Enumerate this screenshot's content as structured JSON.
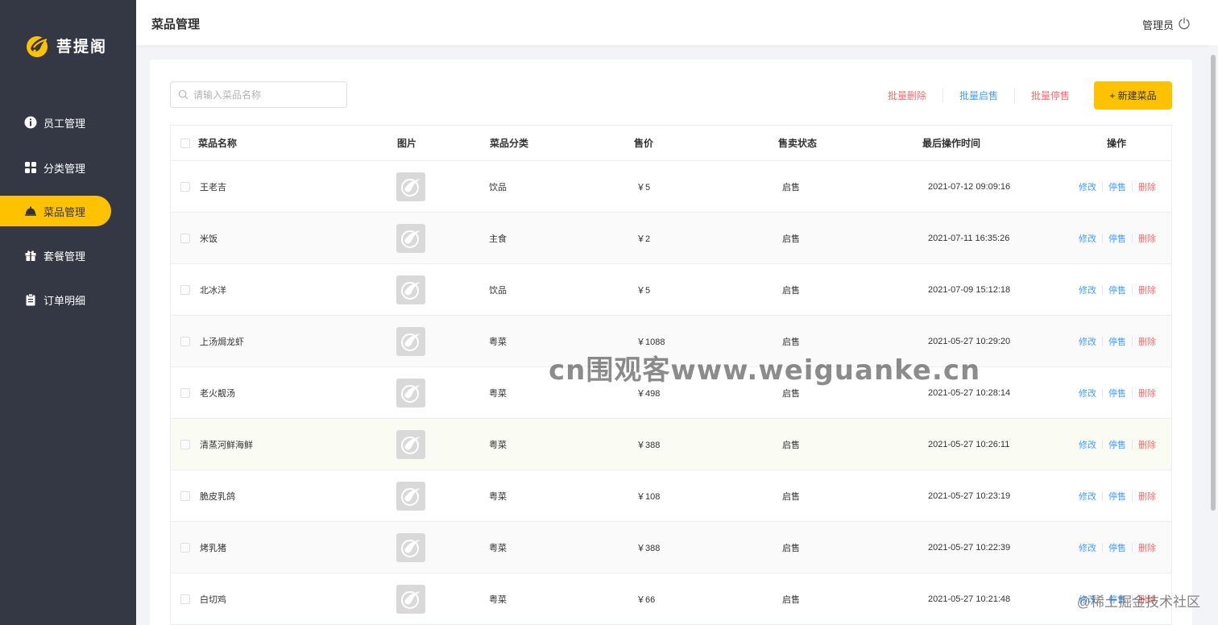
{
  "app": {
    "logo_text": "菩提阁"
  },
  "sidebar": {
    "items": [
      {
        "label": "员工管理",
        "icon": "info-icon",
        "active": false
      },
      {
        "label": "分类管理",
        "icon": "grid-icon",
        "active": false
      },
      {
        "label": "菜品管理",
        "icon": "dish-cover-icon",
        "active": true
      },
      {
        "label": "套餐管理",
        "icon": "gift-icon",
        "active": false
      },
      {
        "label": "订单明细",
        "icon": "clipboard-icon",
        "active": false
      }
    ]
  },
  "header": {
    "title": "菜品管理",
    "user": "管理员",
    "logout_icon": "power-icon"
  },
  "toolbar": {
    "search_placeholder": "请输入菜品名称",
    "batch_delete": "批量删除",
    "batch_enable": "批量启售",
    "batch_disable": "批量停售",
    "new_button": "+ 新建菜品"
  },
  "table": {
    "columns": [
      "菜品名称",
      "图片",
      "菜品分类",
      "售价",
      "售卖状态",
      "最后操作时间",
      "操作"
    ],
    "rows": [
      {
        "name": "王老吉",
        "category": "饮品",
        "price": "￥5",
        "status": "启售",
        "time": "2021-07-12 09:09:16"
      },
      {
        "name": "米饭",
        "category": "主食",
        "price": "￥2",
        "status": "启售",
        "time": "2021-07-11 16:35:26"
      },
      {
        "name": "北冰洋",
        "category": "饮品",
        "price": "￥5",
        "status": "启售",
        "time": "2021-07-09 15:12:18"
      },
      {
        "name": "上汤焗龙虾",
        "category": "粤菜",
        "price": "￥1088",
        "status": "启售",
        "time": "2021-05-27 10:29:20"
      },
      {
        "name": "老火靓汤",
        "category": "粤菜",
        "price": "￥498",
        "status": "启售",
        "time": "2021-05-27 10:28:14"
      },
      {
        "name": "清蒸河鲜海鲜",
        "category": "粤菜",
        "price": "￥388",
        "status": "启售",
        "time": "2021-05-27 10:26:11"
      },
      {
        "name": "脆皮乳鸽",
        "category": "粤菜",
        "price": "￥108",
        "status": "启售",
        "time": "2021-05-27 10:23:19"
      },
      {
        "name": "烤乳猪",
        "category": "粤菜",
        "price": "￥388",
        "status": "启售",
        "time": "2021-05-27 10:22:39"
      },
      {
        "name": "白切鸡",
        "category": "粤菜",
        "price": "￥66",
        "status": "启售",
        "time": "2021-05-27 10:21:48"
      }
    ],
    "row_actions": {
      "edit": "修改",
      "disable": "停售",
      "delete": "删除"
    }
  },
  "watermark": "cn围观客www.weiguanke.cn",
  "corner_watermark": "@稀土掘金技术社区",
  "colors": {
    "sidebar_bg": "#343744",
    "accent": "#ffc200",
    "link_blue": "#419eff",
    "danger_red": "#f56c6c"
  }
}
